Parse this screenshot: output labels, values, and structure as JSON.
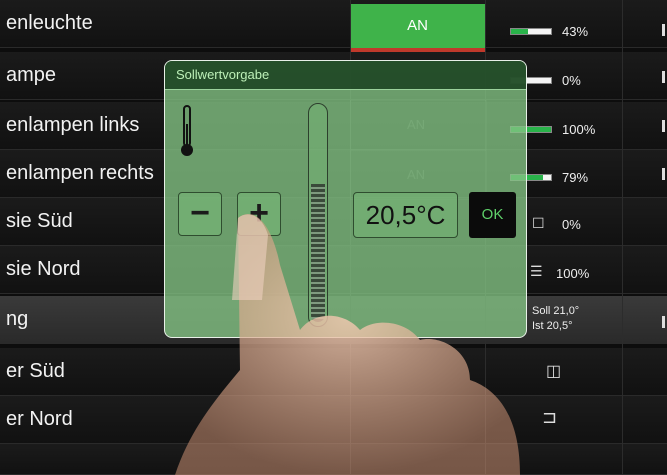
{
  "rows": [
    {
      "label": "enleuchte",
      "control": "on-button",
      "button_label": "AN",
      "percent": "43%",
      "level": 0.43
    },
    {
      "label": "ampe",
      "percent": "0%",
      "level": 0.0
    },
    {
      "label": "enlampen links",
      "percent": "100%",
      "level": 1.0
    },
    {
      "label": "enlampen rechts",
      "percent": "79%",
      "level": 0.79
    },
    {
      "label": "sie Süd",
      "percent": "0%",
      "icon": "checkbox-icon"
    },
    {
      "label": "sie Nord",
      "percent": "100%",
      "icon": "blind-icon"
    },
    {
      "label": "ng",
      "soll": "Soll 21,0°",
      "ist": "Ist  20,5°"
    },
    {
      "label": "er Süd",
      "icon": "window-icon"
    },
    {
      "label": "er Nord",
      "icon": "door-icon"
    }
  ],
  "ghost_labels": {
    "an_1": "AN",
    "an_2": "AN"
  },
  "dialog": {
    "title": "Sollwertvorgabe",
    "minus_label": "−",
    "plus_label": "+",
    "temperature": "20,5°C",
    "ok_label": "OK",
    "slider_level": 0.62,
    "icons": [
      "thermometer-icon",
      "minus-icon",
      "plus-icon"
    ]
  },
  "colors": {
    "accent_green": "#3fb34a",
    "dialog_green": "#84c484",
    "ok_text": "#5fd16a"
  }
}
